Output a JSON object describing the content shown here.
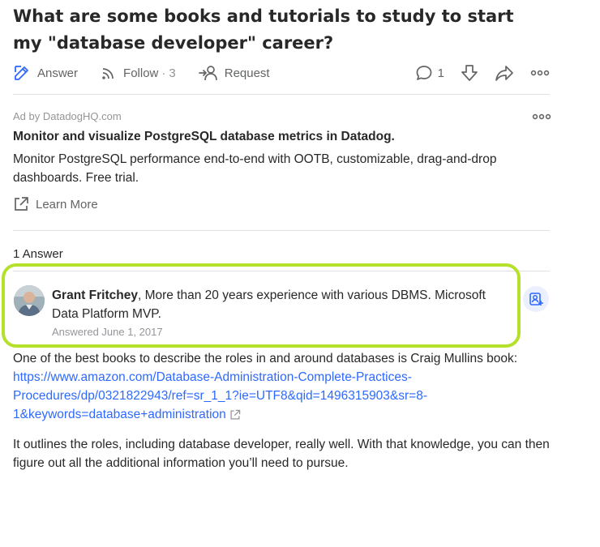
{
  "question": {
    "title": "What are some books and tutorials to study to start my \"database developer\" career?"
  },
  "actions": {
    "answer_label": "Answer",
    "follow_label": "Follow",
    "follow_sep": "·",
    "follow_count": "3",
    "request_label": "Request",
    "comment_count": "1"
  },
  "ad": {
    "by": "Ad by DatadogHQ.com",
    "title": "Monitor and visualize PostgreSQL database metrics in Datadog.",
    "body": "Monitor PostgreSQL performance end-to-end with OOTB, customizable, drag-and-drop dashboards. Free trial.",
    "cta": "Learn More"
  },
  "answers": {
    "count_label": "1 Answer",
    "items": [
      {
        "author_name": "Grant Fritchey",
        "author_credential": ", More than 20 years experience with various DBMS. Microsoft Data Platform MVP.",
        "answered": "Answered June 1, 2017",
        "paragraph1_text": "One of the best books to describe the roles in and around databases is Craig Mullins book: ",
        "link": "https://www.amazon.com/Database-Administration-Complete-Practices-Procedures/dp/0321822943/ref=sr_1_1?ie=UTF8&qid=1496315903&sr=8-1&keywords=database+administration",
        "paragraph2": "It outlines the roles, including database developer, really well. With that knowledge, you can then figure out all the additional information you’ll need to pursue."
      }
    ]
  },
  "colors": {
    "highlight": "#b5e02c",
    "link": "#2e69ff",
    "text": "#282829",
    "muted": "#636466"
  }
}
